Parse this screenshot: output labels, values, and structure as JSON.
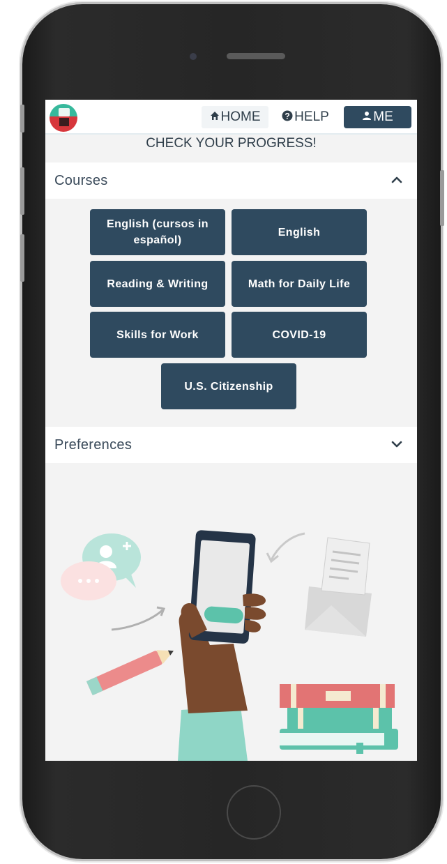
{
  "header": {
    "home_label": "HOME",
    "help_label": "HELP",
    "me_label": "ME"
  },
  "banner": {
    "text": "CHECK YOUR PROGRESS!"
  },
  "courses": {
    "title": "Courses",
    "items": [
      {
        "label": "English (cursos in español)"
      },
      {
        "label": "English"
      },
      {
        "label": "Reading & Writing"
      },
      {
        "label": "Math for Daily Life"
      },
      {
        "label": "Skills for Work"
      },
      {
        "label": "COVID-19"
      },
      {
        "label": "U.S. Citizenship"
      }
    ]
  },
  "preferences": {
    "title": "Preferences"
  },
  "colors": {
    "button_bg": "#2f4a5f",
    "accent_teal": "#37b99c",
    "accent_red": "#d7363b"
  },
  "icons": {
    "home": "house-icon",
    "help": "question-circle-icon",
    "me": "user-icon",
    "courses_toggle": "chevron-up-icon",
    "preferences_toggle": "chevron-down-icon"
  }
}
